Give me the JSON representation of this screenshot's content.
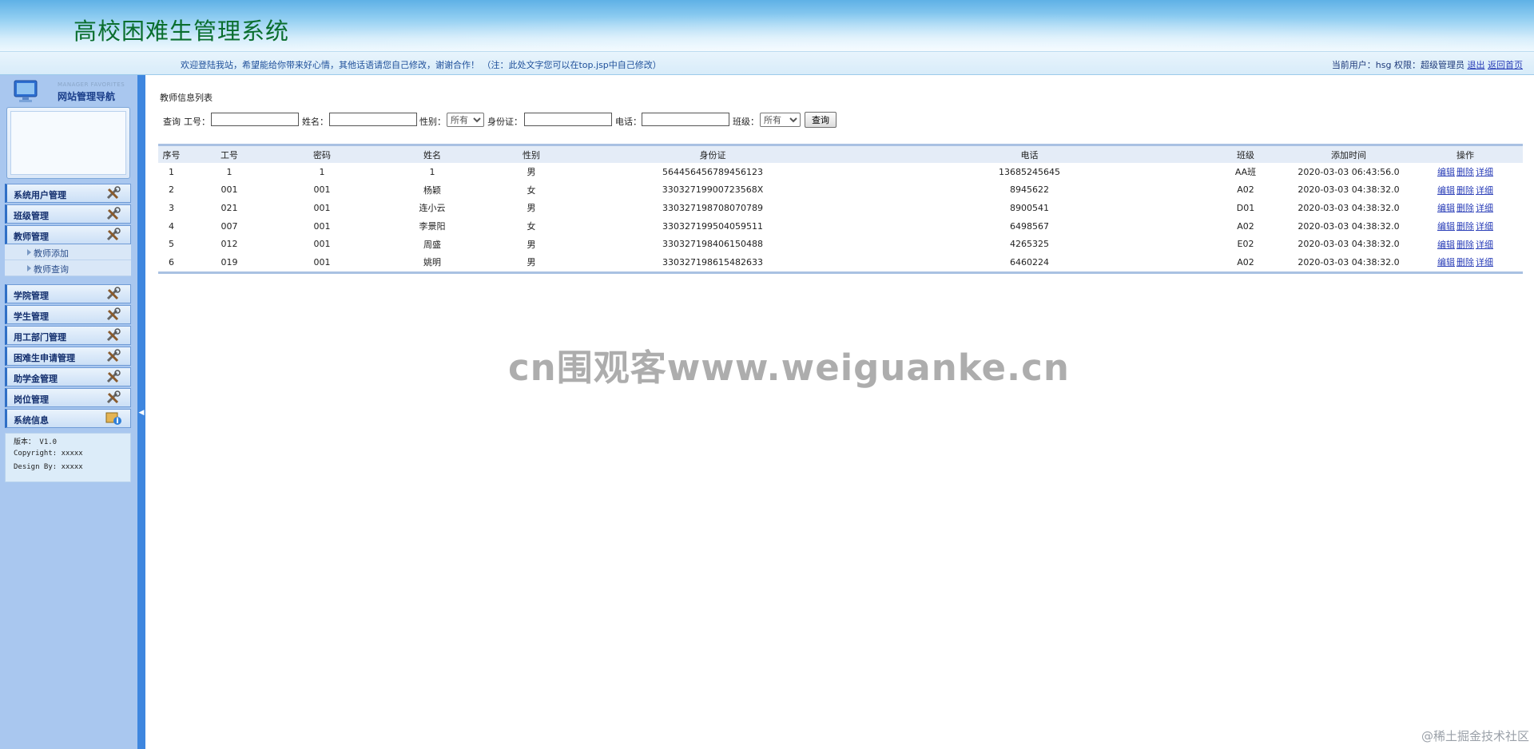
{
  "header": {
    "title": "高校困难生管理系统",
    "welcome": "欢迎登陆我站，希望能给你带来好心情，其他话语请您自己修改，谢谢合作！ （注：此处文字您可以在top.jsp中自己修改）",
    "user_info": "当前用户：hsg 权限：超级管理员",
    "logout_label": "退出",
    "home_label": "返回首页"
  },
  "sidebar": {
    "nav_en": "MANAGER FAVORITES",
    "nav_title": "网站管理导航",
    "menus": [
      {
        "label": "系统用户管理",
        "icon": "tools-icon"
      },
      {
        "label": "班级管理",
        "icon": "tools-icon"
      },
      {
        "label": "教师管理",
        "icon": "tools-icon"
      },
      {
        "label": "学院管理",
        "icon": "tools-icon"
      },
      {
        "label": "学生管理",
        "icon": "tools-icon"
      },
      {
        "label": "用工部门管理",
        "icon": "tools-icon"
      },
      {
        "label": "困难生申请管理",
        "icon": "tools-icon"
      },
      {
        "label": "助学金管理",
        "icon": "tools-icon"
      },
      {
        "label": "岗位管理",
        "icon": "tools-icon"
      },
      {
        "label": "系统信息",
        "icon": "info-icon"
      }
    ],
    "submenus": [
      "教师添加",
      "教师查询"
    ],
    "sysinfo": {
      "version": "版本： V1.0",
      "copyright": "Copyright: xxxxx",
      "design": "Design By:  xxxxx"
    }
  },
  "main": {
    "list_title": "教师信息列表",
    "search": {
      "query_label": "查询",
      "gonghao_label": "工号：",
      "name_label": "姓名：",
      "gender_label": "性别：",
      "gender_selected": "所有",
      "idcard_label": "身份证：",
      "phone_label": "电话：",
      "class_label": "班级：",
      "class_selected": "所有",
      "button_label": "查询"
    },
    "columns": [
      "序号",
      "工号",
      "密码",
      "姓名",
      "性别",
      "身份证",
      "电话",
      "班级",
      "添加时间",
      "操作"
    ],
    "rows": [
      {
        "idx": "1",
        "gonghao": "1",
        "password": "1",
        "name": "1",
        "gender": "男",
        "idcard": "564456456789456123",
        "phone": "13685245645",
        "class": "AA班",
        "time": "2020-03-03 06:43:56.0"
      },
      {
        "idx": "2",
        "gonghao": "001",
        "password": "001",
        "name": "杨颖",
        "gender": "女",
        "idcard": "33032719900723568X",
        "phone": "8945622",
        "class": "A02",
        "time": "2020-03-03 04:38:32.0"
      },
      {
        "idx": "3",
        "gonghao": "021",
        "password": "001",
        "name": "连小云",
        "gender": "男",
        "idcard": "330327198708070789",
        "phone": "8900541",
        "class": "D01",
        "time": "2020-03-03 04:38:32.0"
      },
      {
        "idx": "4",
        "gonghao": "007",
        "password": "001",
        "name": "李景阳",
        "gender": "女",
        "idcard": "330327199504059511",
        "phone": "6498567",
        "class": "A02",
        "time": "2020-03-03 04:38:32.0"
      },
      {
        "idx": "5",
        "gonghao": "012",
        "password": "001",
        "name": "周盛",
        "gender": "男",
        "idcard": "330327198406150488",
        "phone": "4265325",
        "class": "E02",
        "time": "2020-03-03 04:38:32.0"
      },
      {
        "idx": "6",
        "gonghao": "019",
        "password": "001",
        "name": "姚明",
        "gender": "男",
        "idcard": "330327198615482633",
        "phone": "6460224",
        "class": "A02",
        "time": "2020-03-03 04:38:32.0"
      }
    ],
    "ops": [
      "编辑",
      "删除",
      "详细"
    ]
  },
  "watermark": "cn围观客www.weiguanke.cn",
  "corner_mark": "@稀土掘金技术社区",
  "colors": {
    "accent": "#3e86df",
    "title_green": "#0a6e2e",
    "link": "#2a3eb8"
  }
}
